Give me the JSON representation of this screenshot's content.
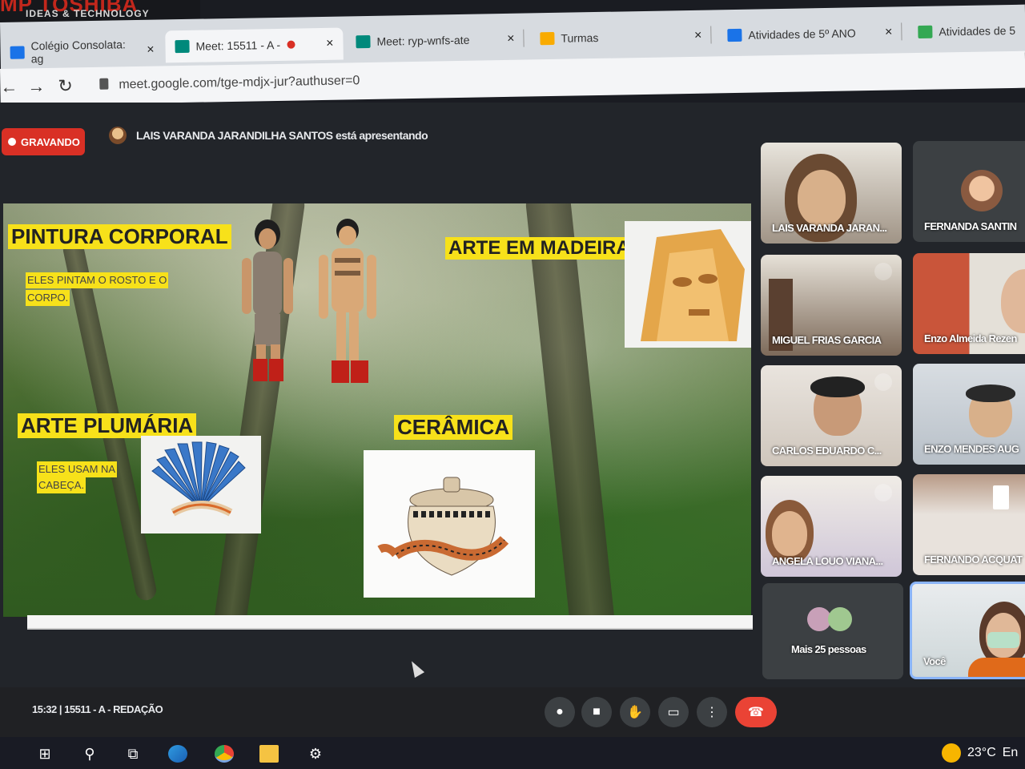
{
  "monitor": {
    "brand": "MP TOSHIBA",
    "tagline": "IDEAS & TECHNOLOGY"
  },
  "browser": {
    "tabs": [
      {
        "label": "Colégio Consolata: ag",
        "favicon": "calendar-24-icon",
        "color": "#1a73e8",
        "close": "×"
      },
      {
        "label": "Meet: 15511 - A -",
        "favicon": "meet-icon",
        "color": "#00897b",
        "close": "×",
        "recording": true
      },
      {
        "label": "Meet: ryp-wnfs-ate",
        "favicon": "meet-icon",
        "color": "#00897b",
        "close": "×"
      },
      {
        "label": "Turmas",
        "favicon": "classroom-icon",
        "color": "#f9ab00",
        "close": "×"
      },
      {
        "label": "Atividades de 5º ANO",
        "favicon": "form-icon",
        "color": "#1a73e8",
        "close": "×"
      },
      {
        "label": "Atividades de 5",
        "favicon": "classroom-icon",
        "color": "#34a853",
        "close": ""
      }
    ],
    "url": "meet.google.com/tge-mdjx-jur?authuser=0"
  },
  "meet": {
    "recording_label": "GRAVANDO",
    "presenter_text": "LAIS VARANDA JARANDILHA SANTOS está apresentando",
    "slide": {
      "sections": [
        {
          "title": "PINTURA CORPORAL",
          "caption": [
            "ELES PINTAM O ROSTO E O",
            "CORPO."
          ]
        },
        {
          "title": "ARTE EM MADEIRA",
          "caption": []
        },
        {
          "title": "ARTE PLUMÁRIA",
          "caption": [
            "ELES USAM NA",
            "CABEÇA."
          ]
        },
        {
          "title": "CERÂMICA",
          "caption": []
        }
      ]
    },
    "participants": [
      {
        "name": "LAIS VARANDA JARAN...",
        "muted": false
      },
      {
        "name": "FERNANDA SANTIN",
        "muted": false
      },
      {
        "name": "MIGUEL FRIAS GARCIA",
        "muted": true
      },
      {
        "name": "Enzo Almeida Rezen",
        "muted": false
      },
      {
        "name": "CARLOS EDUARDO C...",
        "muted": true
      },
      {
        "name": "ENZO MENDES AUG",
        "muted": false
      },
      {
        "name": "ANGELA LOUO VIANA...",
        "muted": true
      },
      {
        "name": "FERNANDO ACQUAT",
        "muted": false
      },
      {
        "name": "Mais 25 pessoas",
        "muted": false
      },
      {
        "name": "Você",
        "muted": false
      }
    ],
    "meeting_info": "15:32  |  15511 - A - REDAÇÃO",
    "controls": [
      "mic-icon",
      "camera-icon",
      "raise-hand-icon",
      "present-icon",
      "more-icon",
      "end-call-icon"
    ]
  },
  "taskbar": {
    "icons": [
      "windows-start-icon",
      "search-icon",
      "task-view-icon",
      "edge-icon",
      "chrome-icon",
      "file-explorer-icon",
      "settings-icon"
    ],
    "weather": {
      "temp": "23°C",
      "lang": "En"
    }
  },
  "colors": {
    "recording_red": "#d93025",
    "end_call_red": "#ea4335",
    "slide_label_yellow": "#f7e11a",
    "self_tile_border": "#8ab4f8"
  }
}
